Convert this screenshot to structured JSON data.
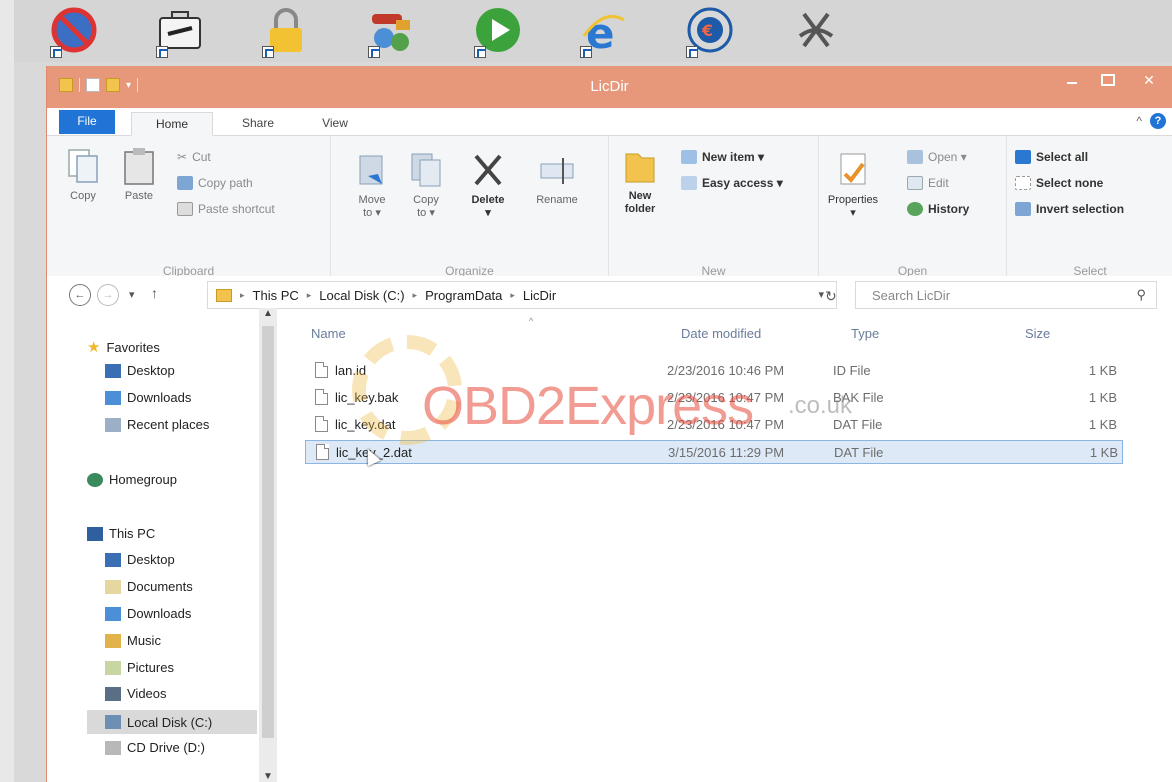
{
  "window": {
    "title": "LicDir"
  },
  "ribbon": {
    "tabs": [
      "File",
      "Home",
      "Share",
      "View"
    ],
    "clipboard": {
      "label": "Clipboard",
      "copy": "Copy",
      "paste": "Paste",
      "cut": "Cut",
      "copy_path": "Copy path",
      "paste_shortcut": "Paste shortcut"
    },
    "organize": {
      "label": "Organize",
      "move_to": "Move",
      "move_to_2": "to ▾",
      "copy_to": "Copy",
      "copy_to_2": "to ▾",
      "delete": "Delete",
      "delete_arrow": "▾",
      "rename": "Rename"
    },
    "new": {
      "label": "New",
      "new_folder": "New",
      "new_folder_2": "folder",
      "new_item": "New item ▾",
      "easy_access": "Easy access ▾"
    },
    "open": {
      "label": "Open",
      "properties": "Properties",
      "properties_arrow": "▾",
      "open": "Open ▾",
      "edit": "Edit",
      "history": "History"
    },
    "select": {
      "label": "Select",
      "select_all": "Select all",
      "select_none": "Select none",
      "invert": "Invert selection"
    }
  },
  "address": {
    "crumbs": [
      "This PC",
      "Local Disk (C:)",
      "ProgramData",
      "LicDir"
    ],
    "search_placeholder": "Search LicDir"
  },
  "navpane": {
    "favorites": "Favorites",
    "fav_items": [
      "Desktop",
      "Downloads",
      "Recent places"
    ],
    "homegroup": "Homegroup",
    "thispc": "This PC",
    "pc_items": [
      "Desktop",
      "Documents",
      "Downloads",
      "Music",
      "Pictures",
      "Videos",
      "Local Disk (C:)",
      "CD Drive (D:)"
    ]
  },
  "files": {
    "headers": {
      "name": "Name",
      "date": "Date modified",
      "type": "Type",
      "size": "Size"
    },
    "rows": [
      {
        "name": "lan.id",
        "date": "2/23/2016 10:46 PM",
        "type": "ID File",
        "size": "1 KB"
      },
      {
        "name": "lic_key.bak",
        "date": "2/23/2016 10:47 PM",
        "type": "BAK File",
        "size": "1 KB"
      },
      {
        "name": "lic_key.dat",
        "date": "2/23/2016 10:47 PM",
        "type": "DAT File",
        "size": "1 KB"
      },
      {
        "name": "lic_key_2.dat",
        "date": "3/15/2016 11:29 PM",
        "type": "DAT File",
        "size": "1 KB"
      }
    ],
    "selected_index": 3
  },
  "watermark": {
    "text": "OBD2Express",
    "suffix": ".co.uk"
  },
  "icons": [
    "forbidden-icon",
    "toolbox-icon",
    "padlock-icon",
    "car-tools-icon",
    "play-icon",
    "internet-explorer-icon",
    "euro-disc-icon",
    "dollar-scribble-icon"
  ]
}
